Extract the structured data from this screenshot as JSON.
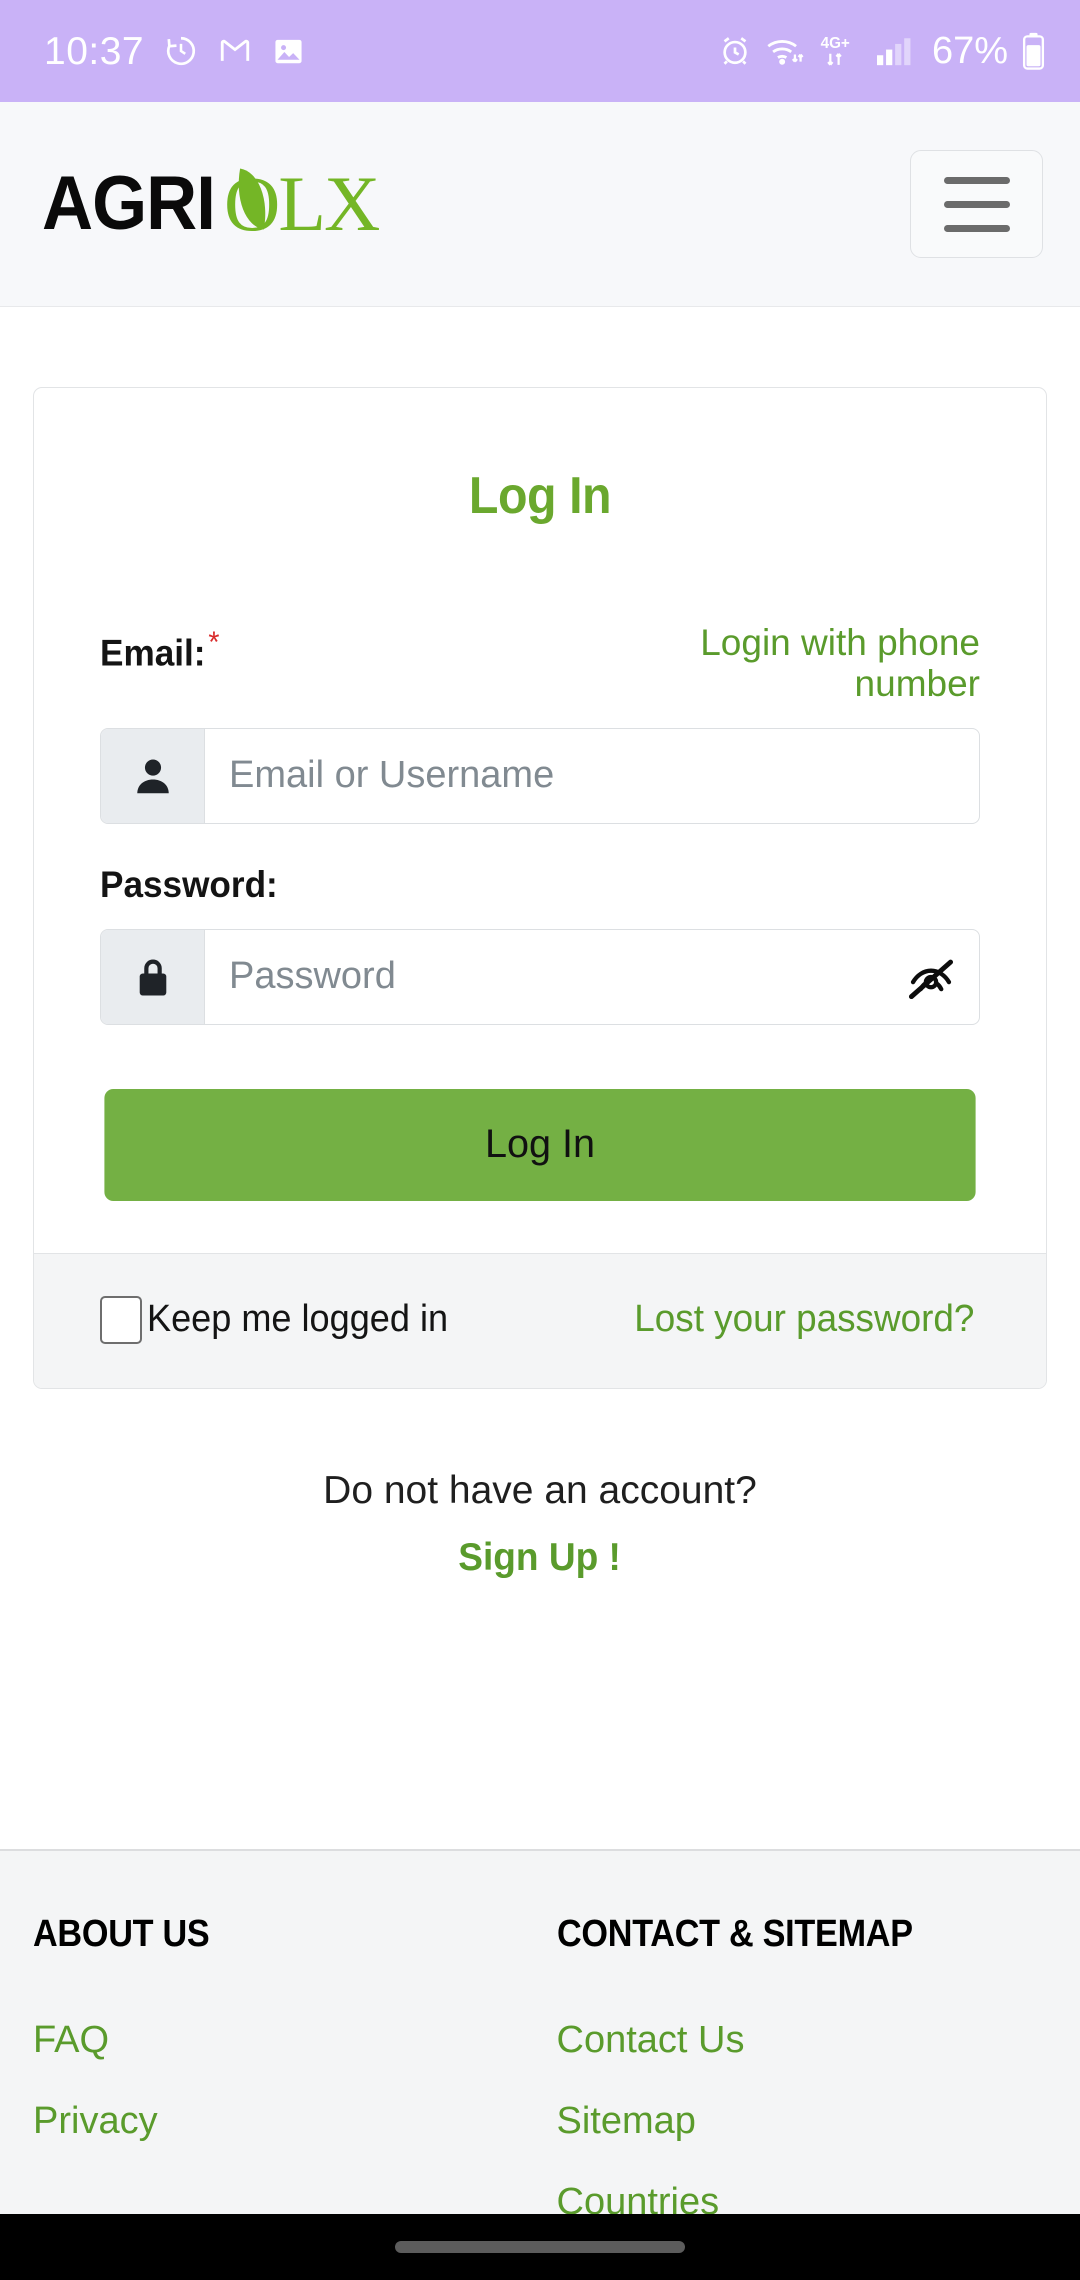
{
  "status_bar": {
    "time": "10:37",
    "battery_percent": "67%",
    "network": "4G+",
    "left_icons": [
      "clock-icon",
      "gmail-icon",
      "photos-icon"
    ],
    "right_icons": [
      "alarm-icon",
      "wifi-icon",
      "mobile-data-icon",
      "signal-icon",
      "battery-icon"
    ],
    "background_color": "#c9b2f7"
  },
  "header": {
    "logo_primary": "AGRI",
    "logo_accent": "OLX",
    "menu_icon": "hamburger-menu-icon"
  },
  "login_card": {
    "title": "Log In",
    "email": {
      "label": "Email:",
      "required_mark": "*",
      "alt_link": "Login with phone number",
      "placeholder": "Email or Username",
      "value": "",
      "prefix_icon": "user-icon"
    },
    "password": {
      "label": "Password:",
      "placeholder": "Password",
      "value": "",
      "prefix_icon": "lock-icon",
      "toggle_icon": "eye-slash-icon"
    },
    "submit_label": "Log In",
    "keep_logged_in": {
      "label": "Keep me logged in",
      "checked": false
    },
    "lost_password": "Lost your password?"
  },
  "signup": {
    "question": "Do not have an account?",
    "link": "Sign Up !"
  },
  "footer": {
    "columns": [
      {
        "heading": "ABOUT US",
        "links": [
          "FAQ",
          "Privacy"
        ]
      },
      {
        "heading": "CONTACT & SITEMAP",
        "links": [
          "Contact Us",
          "Sitemap",
          "Countries"
        ]
      }
    ]
  },
  "theme": {
    "accent_green": "#5a9b2c",
    "button_green": "#74b044",
    "logo_green": "#74b626",
    "required_red": "#d92b2b",
    "status_purple": "#c9b2f7"
  }
}
